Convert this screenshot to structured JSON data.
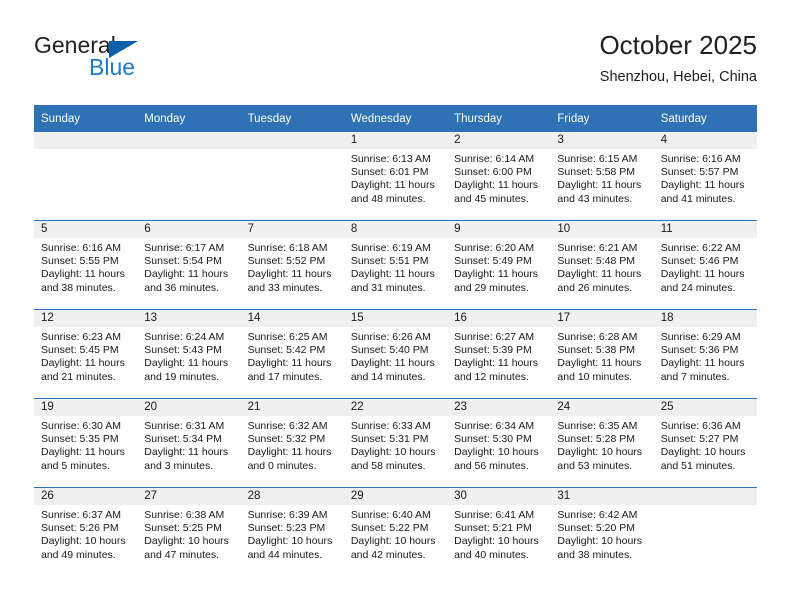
{
  "brand": {
    "word1": "General",
    "word2": "Blue",
    "triangle_icon": "triangle-logo-icon",
    "blue": "#2079c8",
    "dark_blue": "#0b5ea8"
  },
  "header": {
    "title": "October 2025",
    "location": "Shenzhou, Hebei, China"
  },
  "theme": {
    "header_blue": "#2e71b4",
    "daynum_band": "#f0f0f0",
    "cell_bg": "#ffffff"
  },
  "weekdays": [
    "Sunday",
    "Monday",
    "Tuesday",
    "Wednesday",
    "Thursday",
    "Friday",
    "Saturday"
  ],
  "labels": {
    "sunrise": "Sunrise:",
    "sunset": "Sunset:",
    "daylight": "Daylight:"
  },
  "weeks": [
    [
      {
        "day": "",
        "sunrise": "",
        "sunset": "",
        "daylight1": "",
        "daylight2": ""
      },
      {
        "day": "",
        "sunrise": "",
        "sunset": "",
        "daylight1": "",
        "daylight2": ""
      },
      {
        "day": "",
        "sunrise": "",
        "sunset": "",
        "daylight1": "",
        "daylight2": ""
      },
      {
        "day": "1",
        "sunrise": "Sunrise: 6:13 AM",
        "sunset": "Sunset: 6:01 PM",
        "daylight1": "Daylight: 11 hours",
        "daylight2": "and 48 minutes."
      },
      {
        "day": "2",
        "sunrise": "Sunrise: 6:14 AM",
        "sunset": "Sunset: 6:00 PM",
        "daylight1": "Daylight: 11 hours",
        "daylight2": "and 45 minutes."
      },
      {
        "day": "3",
        "sunrise": "Sunrise: 6:15 AM",
        "sunset": "Sunset: 5:58 PM",
        "daylight1": "Daylight: 11 hours",
        "daylight2": "and 43 minutes."
      },
      {
        "day": "4",
        "sunrise": "Sunrise: 6:16 AM",
        "sunset": "Sunset: 5:57 PM",
        "daylight1": "Daylight: 11 hours",
        "daylight2": "and 41 minutes."
      }
    ],
    [
      {
        "day": "5",
        "sunrise": "Sunrise: 6:16 AM",
        "sunset": "Sunset: 5:55 PM",
        "daylight1": "Daylight: 11 hours",
        "daylight2": "and 38 minutes."
      },
      {
        "day": "6",
        "sunrise": "Sunrise: 6:17 AM",
        "sunset": "Sunset: 5:54 PM",
        "daylight1": "Daylight: 11 hours",
        "daylight2": "and 36 minutes."
      },
      {
        "day": "7",
        "sunrise": "Sunrise: 6:18 AM",
        "sunset": "Sunset: 5:52 PM",
        "daylight1": "Daylight: 11 hours",
        "daylight2": "and 33 minutes."
      },
      {
        "day": "8",
        "sunrise": "Sunrise: 6:19 AM",
        "sunset": "Sunset: 5:51 PM",
        "daylight1": "Daylight: 11 hours",
        "daylight2": "and 31 minutes."
      },
      {
        "day": "9",
        "sunrise": "Sunrise: 6:20 AM",
        "sunset": "Sunset: 5:49 PM",
        "daylight1": "Daylight: 11 hours",
        "daylight2": "and 29 minutes."
      },
      {
        "day": "10",
        "sunrise": "Sunrise: 6:21 AM",
        "sunset": "Sunset: 5:48 PM",
        "daylight1": "Daylight: 11 hours",
        "daylight2": "and 26 minutes."
      },
      {
        "day": "11",
        "sunrise": "Sunrise: 6:22 AM",
        "sunset": "Sunset: 5:46 PM",
        "daylight1": "Daylight: 11 hours",
        "daylight2": "and 24 minutes."
      }
    ],
    [
      {
        "day": "12",
        "sunrise": "Sunrise: 6:23 AM",
        "sunset": "Sunset: 5:45 PM",
        "daylight1": "Daylight: 11 hours",
        "daylight2": "and 21 minutes."
      },
      {
        "day": "13",
        "sunrise": "Sunrise: 6:24 AM",
        "sunset": "Sunset: 5:43 PM",
        "daylight1": "Daylight: 11 hours",
        "daylight2": "and 19 minutes."
      },
      {
        "day": "14",
        "sunrise": "Sunrise: 6:25 AM",
        "sunset": "Sunset: 5:42 PM",
        "daylight1": "Daylight: 11 hours",
        "daylight2": "and 17 minutes."
      },
      {
        "day": "15",
        "sunrise": "Sunrise: 6:26 AM",
        "sunset": "Sunset: 5:40 PM",
        "daylight1": "Daylight: 11 hours",
        "daylight2": "and 14 minutes."
      },
      {
        "day": "16",
        "sunrise": "Sunrise: 6:27 AM",
        "sunset": "Sunset: 5:39 PM",
        "daylight1": "Daylight: 11 hours",
        "daylight2": "and 12 minutes."
      },
      {
        "day": "17",
        "sunrise": "Sunrise: 6:28 AM",
        "sunset": "Sunset: 5:38 PM",
        "daylight1": "Daylight: 11 hours",
        "daylight2": "and 10 minutes."
      },
      {
        "day": "18",
        "sunrise": "Sunrise: 6:29 AM",
        "sunset": "Sunset: 5:36 PM",
        "daylight1": "Daylight: 11 hours",
        "daylight2": "and 7 minutes."
      }
    ],
    [
      {
        "day": "19",
        "sunrise": "Sunrise: 6:30 AM",
        "sunset": "Sunset: 5:35 PM",
        "daylight1": "Daylight: 11 hours",
        "daylight2": "and 5 minutes."
      },
      {
        "day": "20",
        "sunrise": "Sunrise: 6:31 AM",
        "sunset": "Sunset: 5:34 PM",
        "daylight1": "Daylight: 11 hours",
        "daylight2": "and 3 minutes."
      },
      {
        "day": "21",
        "sunrise": "Sunrise: 6:32 AM",
        "sunset": "Sunset: 5:32 PM",
        "daylight1": "Daylight: 11 hours",
        "daylight2": "and 0 minutes."
      },
      {
        "day": "22",
        "sunrise": "Sunrise: 6:33 AM",
        "sunset": "Sunset: 5:31 PM",
        "daylight1": "Daylight: 10 hours",
        "daylight2": "and 58 minutes."
      },
      {
        "day": "23",
        "sunrise": "Sunrise: 6:34 AM",
        "sunset": "Sunset: 5:30 PM",
        "daylight1": "Daylight: 10 hours",
        "daylight2": "and 56 minutes."
      },
      {
        "day": "24",
        "sunrise": "Sunrise: 6:35 AM",
        "sunset": "Sunset: 5:28 PM",
        "daylight1": "Daylight: 10 hours",
        "daylight2": "and 53 minutes."
      },
      {
        "day": "25",
        "sunrise": "Sunrise: 6:36 AM",
        "sunset": "Sunset: 5:27 PM",
        "daylight1": "Daylight: 10 hours",
        "daylight2": "and 51 minutes."
      }
    ],
    [
      {
        "day": "26",
        "sunrise": "Sunrise: 6:37 AM",
        "sunset": "Sunset: 5:26 PM",
        "daylight1": "Daylight: 10 hours",
        "daylight2": "and 49 minutes."
      },
      {
        "day": "27",
        "sunrise": "Sunrise: 6:38 AM",
        "sunset": "Sunset: 5:25 PM",
        "daylight1": "Daylight: 10 hours",
        "daylight2": "and 47 minutes."
      },
      {
        "day": "28",
        "sunrise": "Sunrise: 6:39 AM",
        "sunset": "Sunset: 5:23 PM",
        "daylight1": "Daylight: 10 hours",
        "daylight2": "and 44 minutes."
      },
      {
        "day": "29",
        "sunrise": "Sunrise: 6:40 AM",
        "sunset": "Sunset: 5:22 PM",
        "daylight1": "Daylight: 10 hours",
        "daylight2": "and 42 minutes."
      },
      {
        "day": "30",
        "sunrise": "Sunrise: 6:41 AM",
        "sunset": "Sunset: 5:21 PM",
        "daylight1": "Daylight: 10 hours",
        "daylight2": "and 40 minutes."
      },
      {
        "day": "31",
        "sunrise": "Sunrise: 6:42 AM",
        "sunset": "Sunset: 5:20 PM",
        "daylight1": "Daylight: 10 hours",
        "daylight2": "and 38 minutes."
      },
      {
        "day": "",
        "sunrise": "",
        "sunset": "",
        "daylight1": "",
        "daylight2": ""
      }
    ]
  ]
}
